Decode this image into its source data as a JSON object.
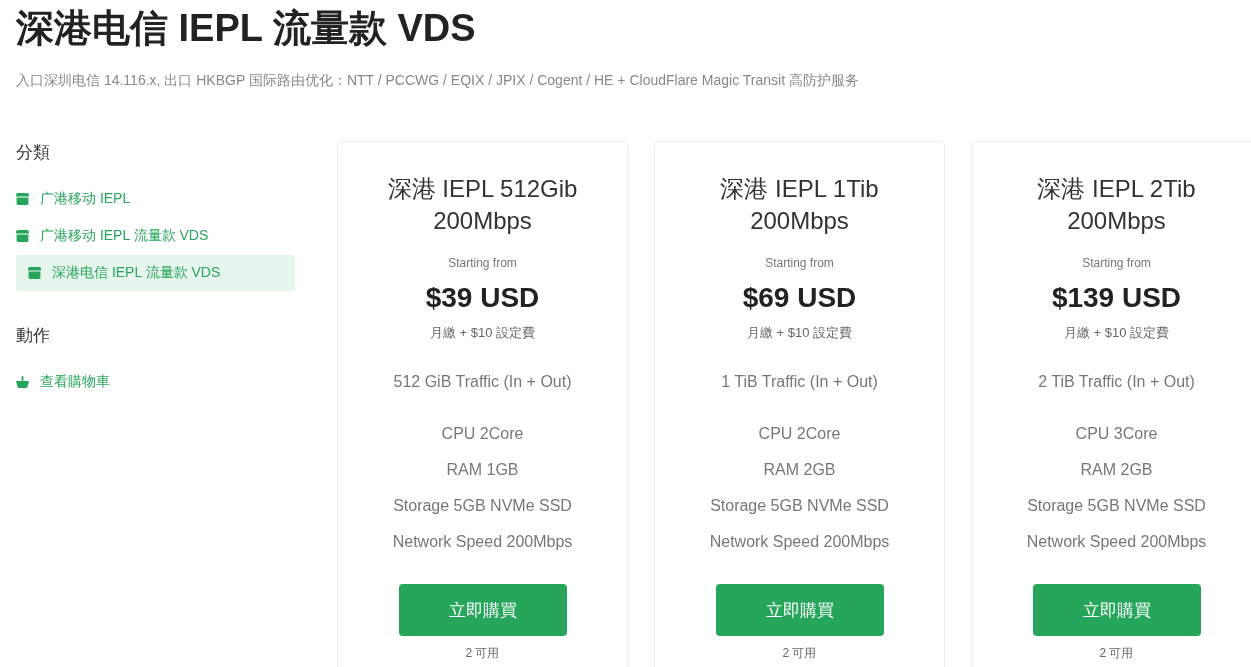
{
  "page": {
    "title": "深港电信 IEPL 流量款 VDS",
    "subtitle": "入口深圳电信 14.116.x, 出口 HKBGP 国际路由优化：NTT / PCCWG / EQIX / JPIX / Cogent / HE + CloudFlare Magic Transit 高防护服务"
  },
  "sidebar": {
    "sections": [
      {
        "heading": "分類",
        "items": [
          {
            "kind": "category",
            "label": "广港移动 IEPL",
            "selected": false
          },
          {
            "kind": "category",
            "label": "广港移动 IEPL 流量款 VDS",
            "selected": false
          },
          {
            "kind": "category",
            "label": "深港电信 IEPL 流量款 VDS",
            "selected": true
          }
        ]
      },
      {
        "heading": "動作",
        "items": [
          {
            "kind": "cart",
            "label": "查看購物車",
            "selected": false
          }
        ]
      }
    ]
  },
  "products": [
    {
      "name": "深港 IEPL 512Gib 200Mbps",
      "price_prefix": "Starting from",
      "price": "$39 USD",
      "billing": "月繳 + $10 設定費",
      "traffic": "512 GiB Traffic (In + Out)",
      "specs": [
        "CPU 2Core",
        "RAM 1GB",
        "Storage 5GB NVMe SSD",
        "Network Speed 200Mbps"
      ],
      "button": "立即購買",
      "availability": "2 可用"
    },
    {
      "name": "深港 IEPL 1Tib 200Mbps",
      "price_prefix": "Starting from",
      "price": "$69 USD",
      "billing": "月繳 + $10 設定費",
      "traffic": "1 TiB Traffic (In + Out)",
      "specs": [
        "CPU 2Core",
        "RAM 2GB",
        "Storage 5GB NVMe SSD",
        "Network Speed 200Mbps"
      ],
      "button": "立即購買",
      "availability": "2 可用"
    },
    {
      "name": "深港 IEPL 2Tib 200Mbps",
      "price_prefix": "Starting from",
      "price": "$139 USD",
      "billing": "月繳 + $10 設定費",
      "traffic": "2 TiB Traffic (In + Out)",
      "specs": [
        "CPU 3Core",
        "RAM 2GB",
        "Storage 5GB NVMe SSD",
        "Network Speed 200Mbps"
      ],
      "button": "立即購買",
      "availability": "2 可用"
    }
  ]
}
